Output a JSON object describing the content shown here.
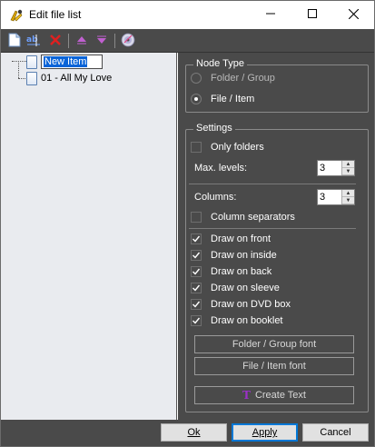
{
  "window": {
    "title": "Edit file list"
  },
  "titlebar": {
    "minimize_icon": "minimize-icon",
    "maximize_icon": "maximize-icon",
    "close_icon": "close-icon"
  },
  "toolbar": {
    "buttons": [
      "new-item-icon",
      "rename-icon",
      "delete-icon",
      "move-up-icon",
      "move-down-icon",
      "disc-icon"
    ]
  },
  "tree": {
    "items": [
      {
        "label": "New Item",
        "editing": true
      },
      {
        "label": "01 - All My Love",
        "editing": false
      }
    ]
  },
  "node_type": {
    "title": "Node Type",
    "options": [
      {
        "label": "Folder / Group",
        "selected": false
      },
      {
        "label": "File / Item",
        "selected": true
      }
    ]
  },
  "settings": {
    "title": "Settings",
    "only_folders": {
      "label": "Only folders",
      "checked": false
    },
    "max_levels": {
      "label": "Max. levels:",
      "value": "3"
    },
    "columns": {
      "label": "Columns:",
      "value": "3"
    },
    "column_separators": {
      "label": "Column separators",
      "checked": false
    },
    "draw_options": [
      {
        "label": "Draw on front",
        "checked": true
      },
      {
        "label": "Draw on inside",
        "checked": true
      },
      {
        "label": "Draw on back",
        "checked": true
      },
      {
        "label": "Draw on sleeve",
        "checked": true
      },
      {
        "label": "Draw on DVD box",
        "checked": true
      },
      {
        "label": "Draw on booklet",
        "checked": true
      }
    ],
    "folder_font_button": "Folder / Group font",
    "item_font_button": "File / Item font",
    "create_text_button": "Create Text",
    "create_text_icon": "T"
  },
  "footer": {
    "ok": "Ok",
    "apply": "Apply",
    "cancel": "Cancel"
  },
  "colors": {
    "panel": "#4a4a4a",
    "tree_bg": "#e9ebef",
    "selection": "#0a64d8",
    "accent": "#0078d7"
  }
}
